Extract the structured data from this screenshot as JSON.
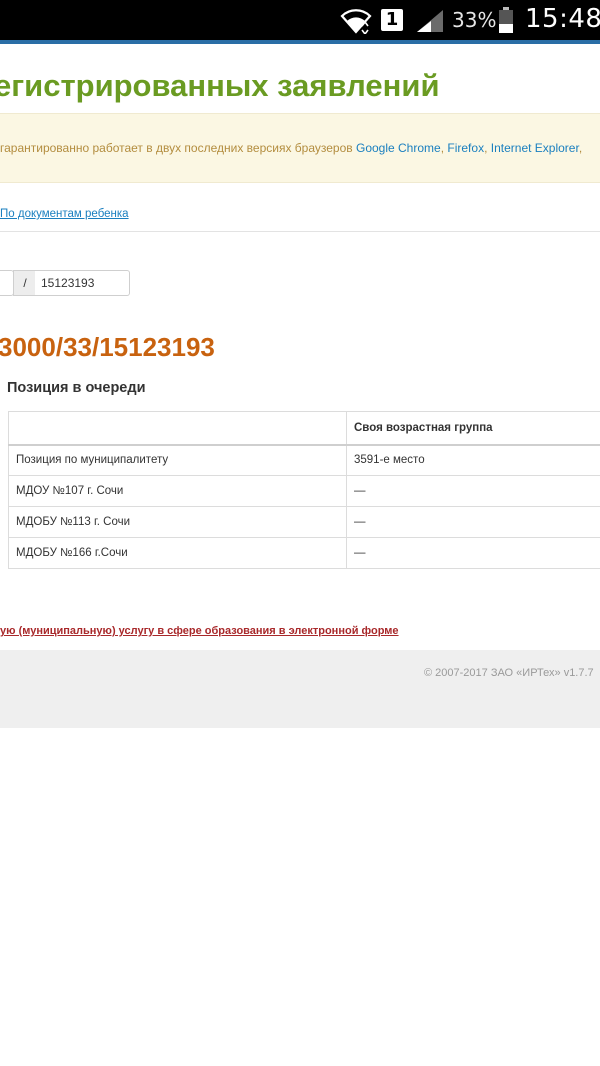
{
  "status_bar": {
    "sim_slot": "1",
    "battery_percent": "33%",
    "time": "15:48"
  },
  "page": {
    "title": "егистрированных заявлений"
  },
  "notice": {
    "text": "гарантированно работает в двух последних версиях браузеров",
    "browsers": [
      "Google Chrome",
      "Firefox",
      "Internet Explorer"
    ],
    "separator": ",",
    "trailing": ","
  },
  "search": {
    "doc_link": "По документам ребенка",
    "slash": "/",
    "number_value": "15123193"
  },
  "result": {
    "application_number": "3000/33/15123193",
    "queue_heading": "Позиция в очереди",
    "table": {
      "headers": [
        "",
        "Своя возрастная группа"
      ],
      "rows": [
        [
          "Позиция по муниципалитету",
          "3591-е место"
        ],
        [
          "МДОУ №107 г. Сочи",
          "—"
        ],
        [
          "МДОБУ №113 г. Сочи",
          "—"
        ],
        [
          "МДОБУ №166 г.Сочи",
          "—"
        ]
      ]
    }
  },
  "service_link": "ую (муниципальную) услугу в сфере образования в электронной форме",
  "footer": {
    "text": "© 2007-2017 ЗАО «ИРТех» v1.7.7"
  },
  "colors": {
    "title_green": "#6a9b22",
    "app_number_orange": "#c8620f",
    "link_blue": "#1a7fbf",
    "service_red": "#a8282a"
  }
}
